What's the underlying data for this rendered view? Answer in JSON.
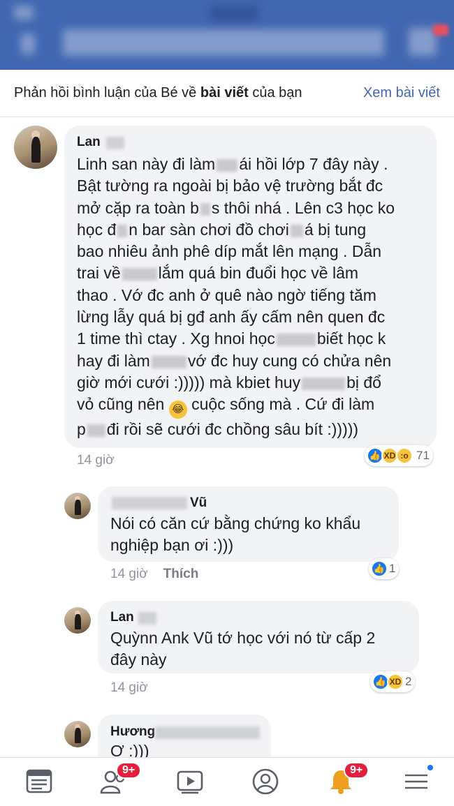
{
  "header": {
    "title_prefix": "Phản hồi bình luận của Bé về ",
    "title_bold": "bài viết",
    "title_suffix": " của bạn",
    "view_post": "Xem bài viết"
  },
  "comment": {
    "author": "Lan",
    "lines": [
      "Linh san này đi làm",
      "ái hồi lớp 7 đây này .",
      "Bật tường ra ngoài bị bảo vệ trường bắt đc",
      "mở cặp ra toàn b",
      "s thôi nhá . Lên c3 học ko",
      "học đ",
      "n bar sàn chơi đồ chơi",
      "á bị tung",
      "bao nhiêu ảnh phê díp mắt lên mạng . Dẫn",
      "trai về",
      "lắm quá bin đuổi học về lâm",
      "thao . Vớ đc anh ở quê nào ngờ tiếng tăm",
      "lừng lẫy quá bị gđ anh ấy cấm nên quen đc",
      "1 time thì ctay . Xg hnoi học",
      "biết học k",
      "hay đi làm",
      "vớ đc huy cung có chửa nên",
      "giờ mới cưới :))))) mà kbiet huy",
      "bị đổ",
      "vỏ cũng nên",
      "cuộc sống mà . Cứ đi làm",
      "p",
      "đi rồi sẽ cưới đc chồng sâu bít :)))))"
    ],
    "time": "14 giờ",
    "reaction_count": "71"
  },
  "replies": [
    {
      "author_suffix": "Vũ",
      "text": "Nói có căn cứ bằng chứng ko khẩu\nnghiệp bạn ơi :)))",
      "time": "14 giờ",
      "like_label": "Thích",
      "reaction_count": "1"
    },
    {
      "author": "Lan",
      "text": "Quỳnn Ank Vũ  tớ học với nó từ cấp 2\nđây này",
      "time": "14 giờ",
      "reaction_count": "2"
    },
    {
      "author": "Hương",
      "text": "Ơ :)))"
    }
  ],
  "nav": {
    "friends_badge": "9+",
    "notifications_badge": "9+"
  },
  "colors": {
    "brand": "#4267b2",
    "like_blue": "#1877f2",
    "badge_red": "#e41e3f",
    "bubble": "#f2f3f5"
  }
}
